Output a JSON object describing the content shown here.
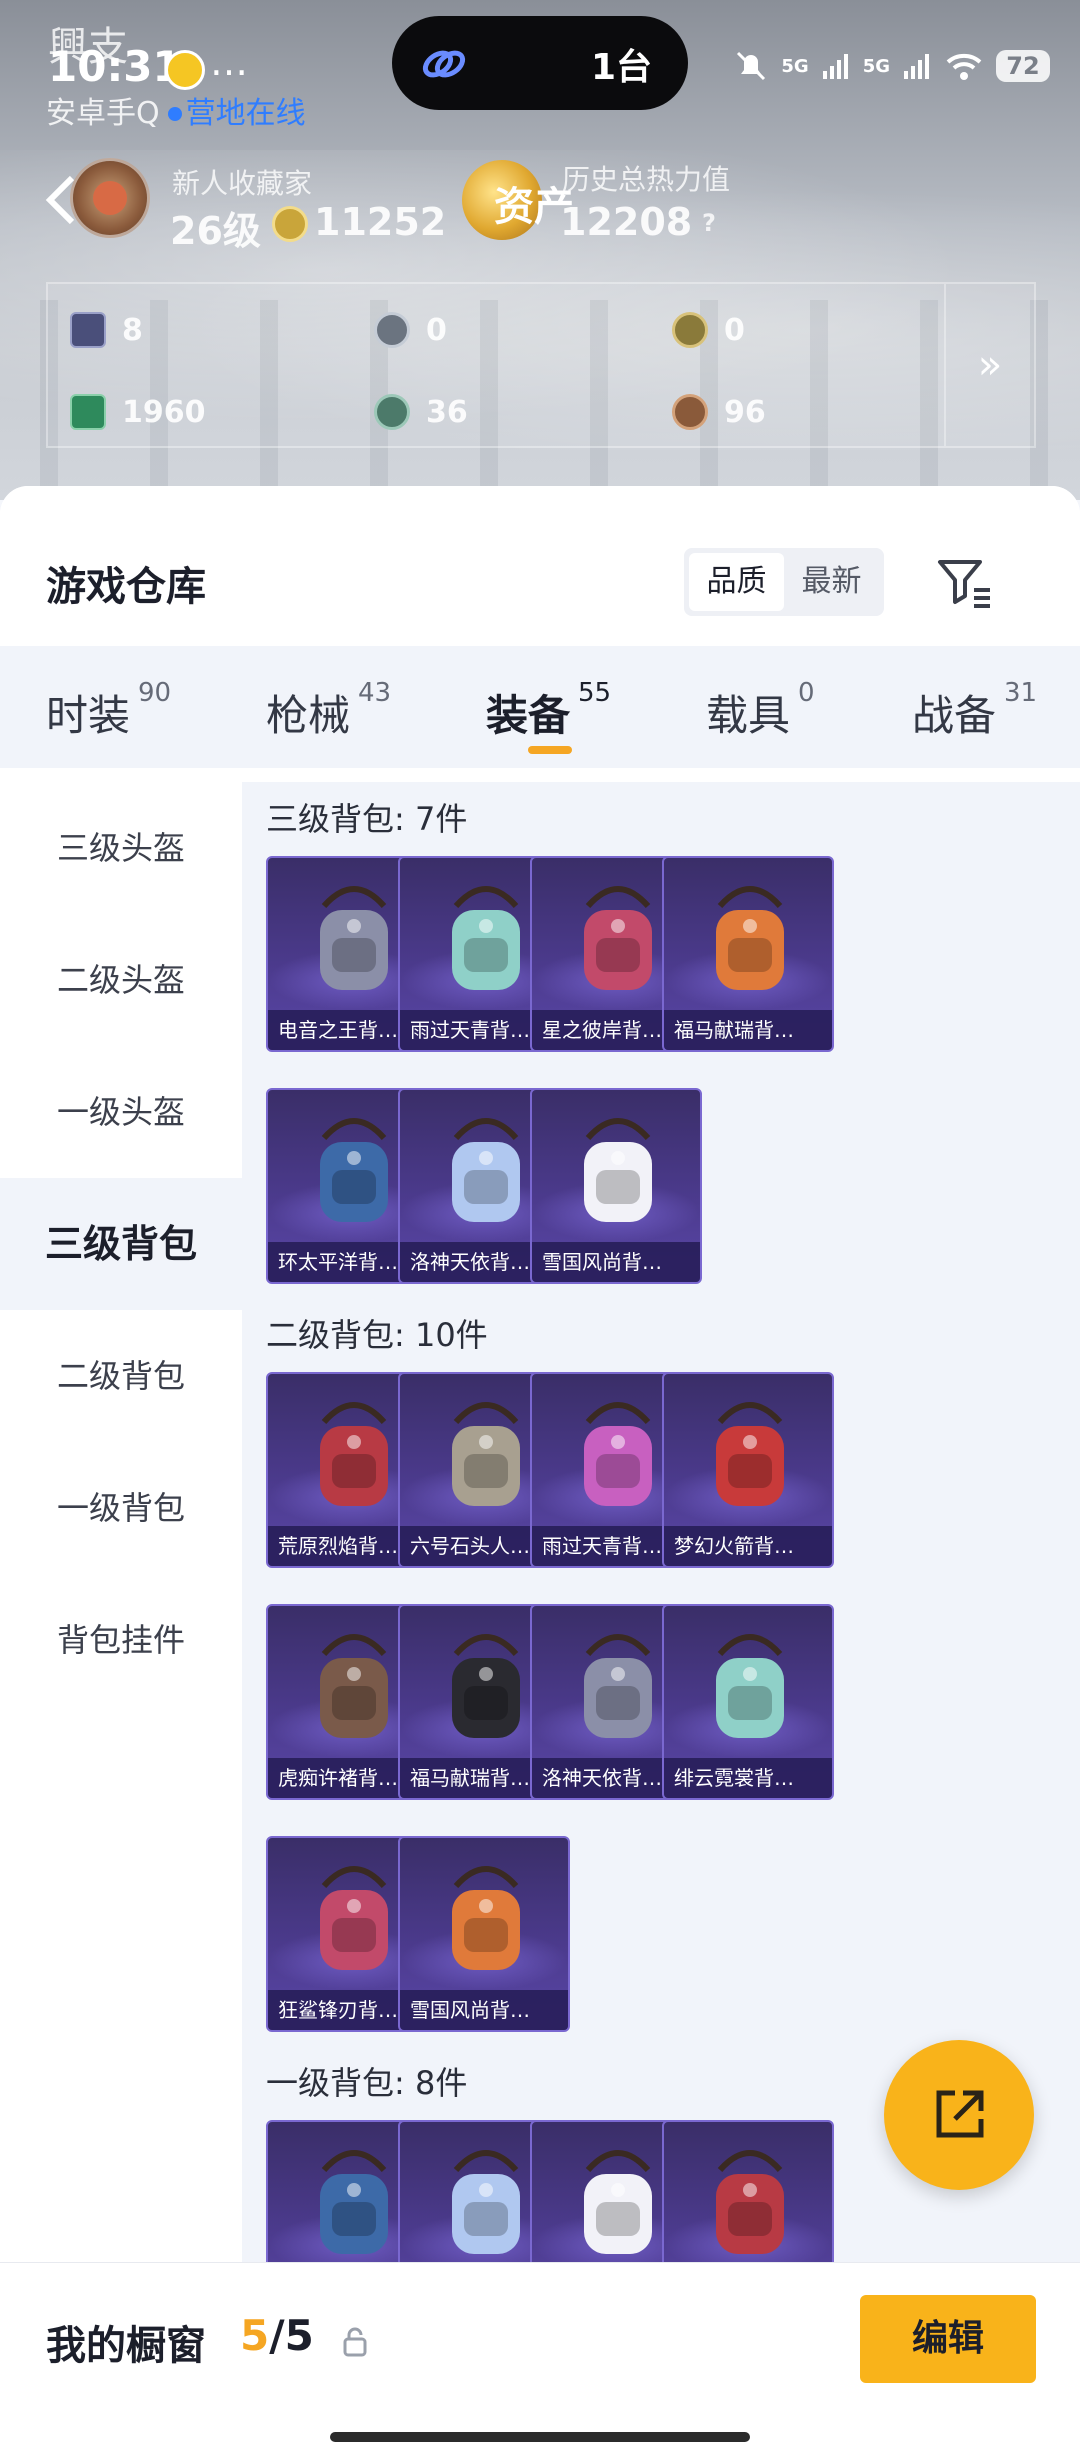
{
  "status_bar": {
    "time": "10:31",
    "ghost_text": "興支",
    "more": "…",
    "island_count": "1台",
    "battery": "72",
    "network_1": "5G",
    "network_2": "5G"
  },
  "subtitle": {
    "device": "安卓手Q",
    "online": "营地在线"
  },
  "profile": {
    "rank_label": "新人收藏家",
    "level": "26级",
    "coins": "11252",
    "asset_label": "资产",
    "history_label": "历史总热力值",
    "history_value": "12208",
    "help": "?"
  },
  "stats": [
    {
      "value": "8",
      "icon": "card-icon",
      "color": "#4a4f7a"
    },
    {
      "value": "0",
      "icon": "silver-coin-icon",
      "color": "#6b7480"
    },
    {
      "value": "0",
      "icon": "gold-coin-icon",
      "color": "#8a7a3a"
    },
    {
      "value": "1960",
      "icon": "green-ticket-icon",
      "color": "#2e8a5c"
    },
    {
      "value": "36",
      "icon": "jade-coin-icon",
      "color": "#4c7a6a"
    },
    {
      "value": "96",
      "icon": "bronze-coin-icon",
      "color": "#8a5a3a"
    }
  ],
  "stats_expand": "»",
  "warehouse": {
    "title": "游戏仓库",
    "sort_options": [
      "品质",
      "最新"
    ],
    "sort_selected": "品质"
  },
  "tabs": [
    {
      "label": "时装",
      "count": "90"
    },
    {
      "label": "枪械",
      "count": "43"
    },
    {
      "label": "装备",
      "count": "55",
      "active": true
    },
    {
      "label": "载具",
      "count": "0"
    },
    {
      "label": "战备",
      "count": "31"
    }
  ],
  "sidebar": [
    "三级头盔",
    "二级头盔",
    "一级头盔",
    "三级背包",
    "二级背包",
    "一级背包",
    "背包挂件"
  ],
  "sidebar_active": "三级背包",
  "sections": [
    {
      "title": "三级背包: 7件",
      "items": [
        "电音之王背…",
        "雨过天青背…",
        "星之彼岸背…",
        "福马献瑞背…",
        "环太平洋背…",
        "洛神天依背…",
        "雪国风尚背…"
      ]
    },
    {
      "title": "二级背包: 10件",
      "items": [
        "荒原烈焰背…",
        "六号石头人…",
        "雨过天青背…",
        "梦幻火箭背…",
        "虎痴许褚背…",
        "福马献瑞背…",
        "洛神天依背…",
        "绯云霓裳背…",
        "狂鲨锋刃背…",
        "雪国风尚背…"
      ]
    },
    {
      "title": "一级背包: 8件",
      "items": [
        "",
        "",
        "",
        ""
      ]
    }
  ],
  "colors": {
    "accent": "#f5a623",
    "button": "#f9b31a",
    "card_purple": "#4b3a8c",
    "online_blue": "#2f7dff"
  },
  "showcase": {
    "title": "我的橱窗",
    "current": "5",
    "total": "/5",
    "edit_label": "编辑"
  }
}
